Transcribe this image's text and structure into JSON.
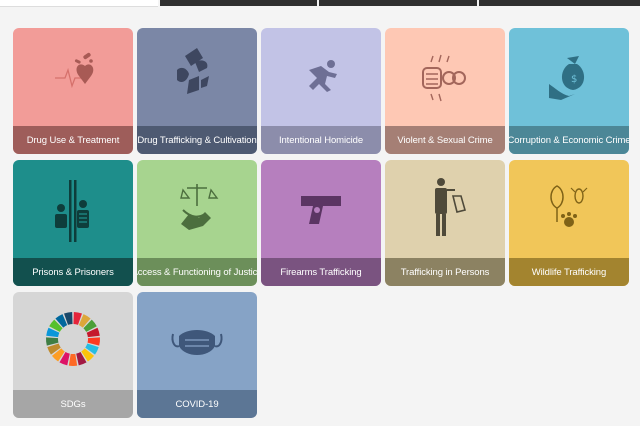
{
  "tiles": [
    {
      "label": "Drug Use & Treatment",
      "bg": "#f29c98",
      "bar": "#9e5d5a",
      "icon": "heart-pills-icon"
    },
    {
      "label": "Drug Trafficking & Cultivation",
      "bg": "#7b87a6",
      "bar": "#4e5a72",
      "icon": "hand-package-icon"
    },
    {
      "label": "Intentional Homicide",
      "bg": "#c2c3e6",
      "bar": "#8c8dab",
      "icon": "falling-person-icon"
    },
    {
      "label": "Violent & Sexual Crime",
      "bg": "#fec8b4",
      "bar": "#a57f75",
      "icon": "fist-gender-icon"
    },
    {
      "label": "Corruption & Economic Crime",
      "bg": "#6fc1d9",
      "bar": "#4c8797",
      "icon": "hand-money-bag-icon"
    },
    {
      "label": "Prisons & Prisoners",
      "bg": "#1e8e8b",
      "bar": "#12504e",
      "icon": "prisoners-bars-icon"
    },
    {
      "label": "Access & Functioning of Justice",
      "bg": "#a7d48f",
      "bar": "#6c8f5a",
      "icon": "scales-hand-icon"
    },
    {
      "label": "Firearms Trafficking",
      "bg": "#b67fbe",
      "bar": "#7a5380",
      "icon": "pistol-icon"
    },
    {
      "label": "Trafficking in Persons",
      "bg": "#dfd1ad",
      "bar": "#8c8262",
      "icon": "person-tag-icon"
    },
    {
      "label": "Wildlife Trafficking",
      "bg": "#f1c659",
      "bar": "#a3842f",
      "icon": "tree-insect-icon"
    },
    {
      "label": "SDGs",
      "bg": "#d6d6d6",
      "bar": "#a6a6a6",
      "icon": "sdg-wheel-icon"
    },
    {
      "label": "COVID-19",
      "bg": "#86a3c6",
      "bar": "#5c7695",
      "icon": "face-mask-icon"
    }
  ]
}
